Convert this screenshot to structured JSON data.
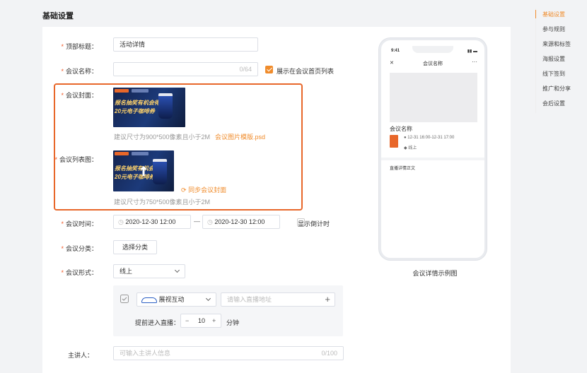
{
  "page_title": "基础设置",
  "fields": {
    "top_title": {
      "label": "顶部标题：",
      "value": "活动详情"
    },
    "meeting_name": {
      "label": "会议名称：",
      "placeholder": "",
      "counter": "0/64",
      "show_on_home_label": "展示在会议首页列表",
      "show_on_home_checked": true
    },
    "cover": {
      "label": "会议封面：",
      "hint": "建议尺寸为900*500像素且小于2M",
      "template_link": "会议图片模版.psd"
    },
    "list_image": {
      "label": "会议列表图：",
      "sync_link": "同步会议封面",
      "hint": "建议尺寸为750*500像素且小于2M"
    },
    "time": {
      "label": "会议时间：",
      "start": "2020-12-30 12:00",
      "separator": "—",
      "end": "2020-12-30 12:00",
      "countdown_label": "显示倒计时",
      "countdown_checked": false
    },
    "category": {
      "label": "会议分类：",
      "button": "选择分类"
    },
    "form": {
      "label": "会议形式：",
      "value": "线上"
    },
    "live": {
      "provider": "展视互动",
      "address_placeholder": "请输入直播地址",
      "add_symbol": "+",
      "advance_label": "提前进入直播：",
      "minus": "−",
      "advance_value": "10",
      "plus": "+",
      "unit": "分钟"
    },
    "speaker": {
      "label": "主讲人：",
      "placeholder": "可输入主讲人信息",
      "counter": "0/100"
    }
  },
  "banner": {
    "line1": "报名抽奖有机会得",
    "line2": "20元电子咖啡券"
  },
  "preview": {
    "status_time": "9:41",
    "close_symbol": "✕",
    "nav_title": "会议名称",
    "more_symbol": "···",
    "meeting_name": "会议名称",
    "time": "12-31 16:00-12-31 17:00",
    "location": "线上",
    "detail_text": "直播详情正文",
    "caption": "会议详情示例图"
  },
  "right_nav": [
    "基础设置",
    "参与规则",
    "来源和标签",
    "海报设置",
    "线下签到",
    "推广和分享",
    "会后设置"
  ],
  "colors": {
    "accent": "#f08c2c",
    "highlight_border": "#e8672a",
    "required": "#f05a28"
  }
}
